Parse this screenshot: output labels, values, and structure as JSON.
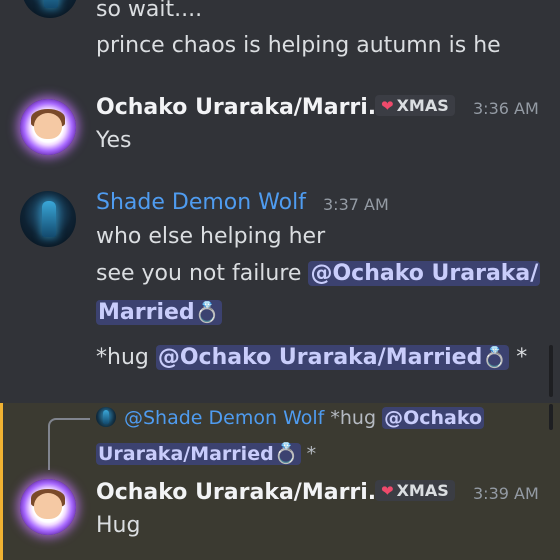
{
  "messages": {
    "top": {
      "lines": [
        "so wait....",
        "prince chaos is helping autumn is he"
      ]
    },
    "m1": {
      "username": "Ochako Uraraka/Marri...",
      "tag": "XMAS",
      "time": "3:36 AM",
      "text": "Yes"
    },
    "m2": {
      "username": "Shade  Demon Wolf",
      "time": "3:37 AM",
      "line1": "who else helping her",
      "line2_prefix": "see you not failure",
      "mention1a": "@Ochako Uraraka/",
      "mention1b": "Married",
      "line4_prefix": "*hug",
      "mention2": "@Ochako Uraraka/Married",
      "line4_suffix": "*"
    },
    "m3": {
      "reply_user": "@Shade  Demon Wolf",
      "reply_prefix": "*hug",
      "reply_mention_a": "@Ochako",
      "reply_mention_b": "Uraraka/Married",
      "reply_suffix": "*",
      "username": "Ochako Uraraka/Marri...",
      "tag": "XMAS",
      "time": "3:39 AM",
      "text": "Hug"
    }
  },
  "icons": {
    "ring": "💍",
    "heart": "❤"
  },
  "colors": {
    "background": "#313338",
    "mention_bg": "#3c4270",
    "mention_fg": "#c9cdfb",
    "highlight_bg": "#3b3a31",
    "highlight_bar": "#f0b232",
    "username_blue": "#4f9cf0"
  }
}
